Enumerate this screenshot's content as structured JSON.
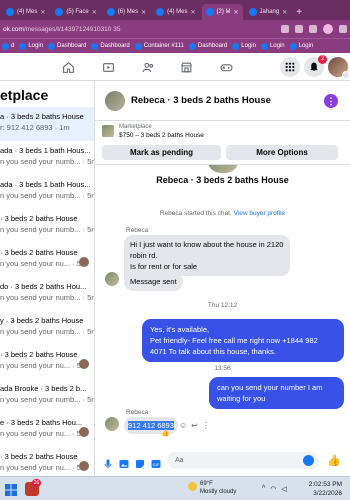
{
  "browser": {
    "tabs": [
      {
        "label": "(4) Mes",
        "active": false
      },
      {
        "label": "(5) Face",
        "active": false
      },
      {
        "label": "(6) Mes",
        "active": false
      },
      {
        "label": "(4) Mes",
        "active": false
      },
      {
        "label": "(2) M",
        "active": true
      },
      {
        "label": "Jahang",
        "active": false
      }
    ],
    "new_tab_symbol": "+",
    "url_host": "ok.com",
    "url_path": "/messages/t/14397124910310 35",
    "bookmarks": [
      {
        "label": "d"
      },
      {
        "label": "Login"
      },
      {
        "label": "Dashboard"
      },
      {
        "label": "Dashboard"
      },
      {
        "label": "Container #111"
      },
      {
        "label": "Dashboard"
      },
      {
        "label": "Login"
      },
      {
        "label": "Login"
      },
      {
        "label": "Login"
      }
    ]
  },
  "fbnav": {
    "notification_count": "2"
  },
  "sidebar": {
    "title": "etplace",
    "conversations": [
      {
        "name": "a · 3 beds 2 baths House",
        "snippet": "r: 912 412 6893 · 1m",
        "selected": true,
        "avatar": false
      },
      {
        "name": "ada · 3 beds 1 bath Hous...",
        "snippet": "n you send your numb... · 5m",
        "selected": false,
        "avatar": false
      },
      {
        "name": "ada · 3 beds 1 bath Hous...",
        "snippet": "n you send your numb... · 5m",
        "selected": false,
        "avatar": false
      },
      {
        "name": "· 3 beds 2 baths House",
        "snippet": "n you send your numb... · 5m",
        "selected": false,
        "avatar": false
      },
      {
        "name": "· 3 beds 2 baths House",
        "snippet": "n you send your nu... · 5m",
        "selected": false,
        "avatar": true
      },
      {
        "name": "do · 3 beds 2 baths Hou...",
        "snippet": "n you send your numb... · 5m",
        "selected": false,
        "avatar": false
      },
      {
        "name": "y · 3 beds 2 baths House",
        "snippet": "n you send your numb... · 5m",
        "selected": false,
        "avatar": false
      },
      {
        "name": "· 3 beds 2 baths House",
        "snippet": "n you send your nu... · 5m",
        "selected": false,
        "avatar": true
      },
      {
        "name": "ada Brooke · 3 beds 2 b...",
        "snippet": "n you send your numb... · 5m",
        "selected": false,
        "avatar": false
      },
      {
        "name": "e · 3 beds 2 baths Hou...",
        "snippet": "n you send your nu... · 5m",
        "selected": false,
        "avatar": true
      },
      {
        "name": "· 3 beds 2 baths House",
        "snippet": "n you send your nu... · 5m",
        "selected": false,
        "avatar": true
      },
      {
        "name": "· 3 beds 2 baths House",
        "snippet": "",
        "selected": false,
        "avatar": true
      }
    ]
  },
  "chat": {
    "header_title": "Rebeca · 3 beds 2 baths House",
    "marketplace_label": "Marketplace",
    "listing": "$750 – 3 beds 2 baths House",
    "mark_pending": "Mark as pending",
    "more_options": "More Options",
    "conversation_title": "Rebeca · 3 beds 2 baths House",
    "system_message": "Rebeca started this chat.",
    "system_link": "View buyer profile",
    "sender_name": "Rebeca",
    "incoming_1": "Hi I just want to know about the house in 2120 robin rd.",
    "incoming_1b": "Is for rent or for sale",
    "incoming_2": "Message sent",
    "time_1": "Thu 12:12",
    "outgoing_1": "Yes, it's available,\nPet friendly- Feel free call me right now +1844 982 4071 To talk about this house, thanks.",
    "time_2": "13:56",
    "outgoing_2": "can you send your number I am waiting for you",
    "sender_name_2": "Rebeca",
    "incoming_3": "912 412 6893",
    "composer_placeholder": "Aa"
  },
  "taskbar": {
    "app_badge": "26",
    "weather_temp": "69°F",
    "weather_text": "Mostly cloudy",
    "time": "2:02:53 PM",
    "date": "3/22/2026"
  },
  "colors": {
    "browser_chrome": "#8a3c80",
    "outgoing_bubble": "#3852e8",
    "fb_blue": "#1877f2"
  }
}
